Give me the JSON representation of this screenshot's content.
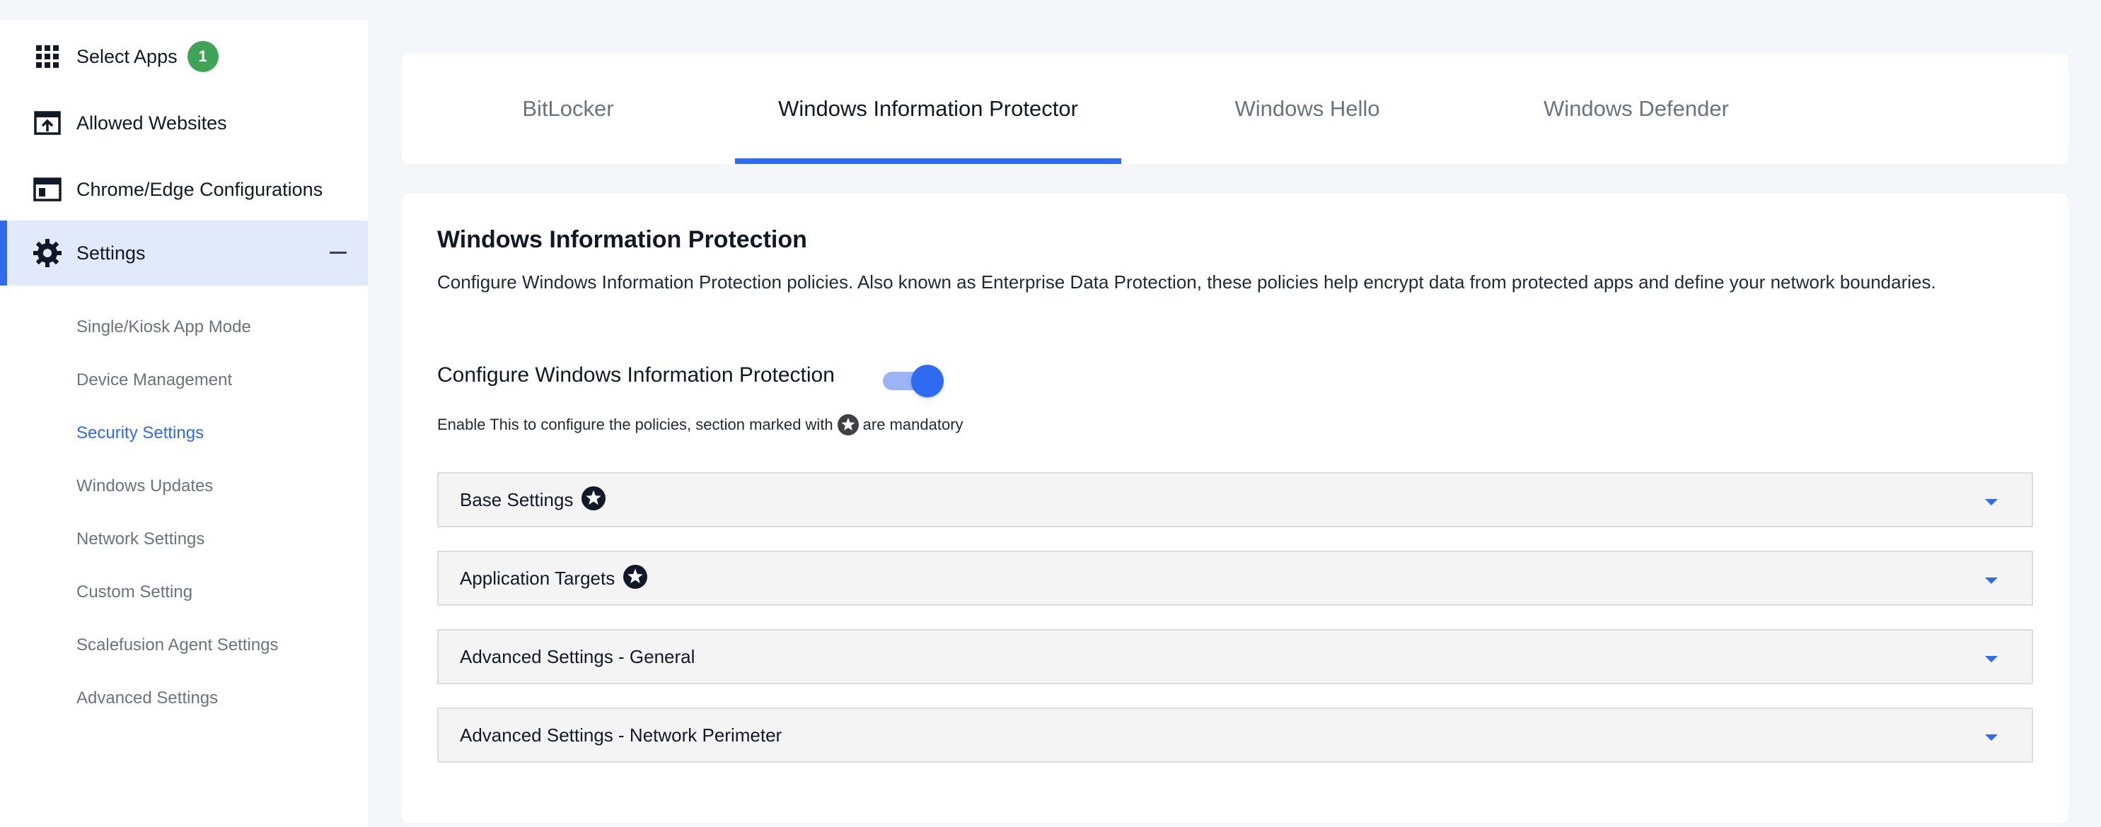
{
  "sidebar": {
    "main_items": [
      {
        "label": "Select Apps",
        "icon": "grid-icon",
        "badge": "1"
      },
      {
        "label": "Allowed Websites",
        "icon": "upload-window-icon"
      },
      {
        "label": "Chrome/Edge Configurations",
        "icon": "browser-window-icon"
      },
      {
        "label": "Settings",
        "icon": "gear-icon"
      }
    ],
    "sub_items": [
      "Single/Kiosk App Mode",
      "Device Management",
      "Security Settings",
      "Windows Updates",
      "Network Settings",
      "Custom Setting",
      "Scalefusion Agent Settings",
      "Advanced Settings"
    ]
  },
  "tabs": [
    {
      "label": "BitLocker"
    },
    {
      "label": "Windows Information Protector"
    },
    {
      "label": "Windows Hello"
    },
    {
      "label": "Windows Defender"
    }
  ],
  "section": {
    "title": "Windows Information Protection",
    "description": "Configure Windows Information Protection policies. Also known as Enterprise Data Protection, these policies help encrypt data from protected apps and define your network boundaries.",
    "toggle_label": "Configure Windows Information Protection",
    "toggle_on": true,
    "hint_before": "Enable This to configure the policies, section marked with",
    "hint_after": "are mandatory"
  },
  "accordions": [
    {
      "label": "Base Settings",
      "mandatory": true
    },
    {
      "label": "Application Targets",
      "mandatory": true
    },
    {
      "label": "Advanced Settings - General",
      "mandatory": false
    },
    {
      "label": "Advanced Settings - Network Perimeter",
      "mandatory": false
    }
  ],
  "colors": {
    "accent": "#2f6bf0",
    "badge": "#3fa556",
    "active_bg": "#e2e9fb"
  }
}
